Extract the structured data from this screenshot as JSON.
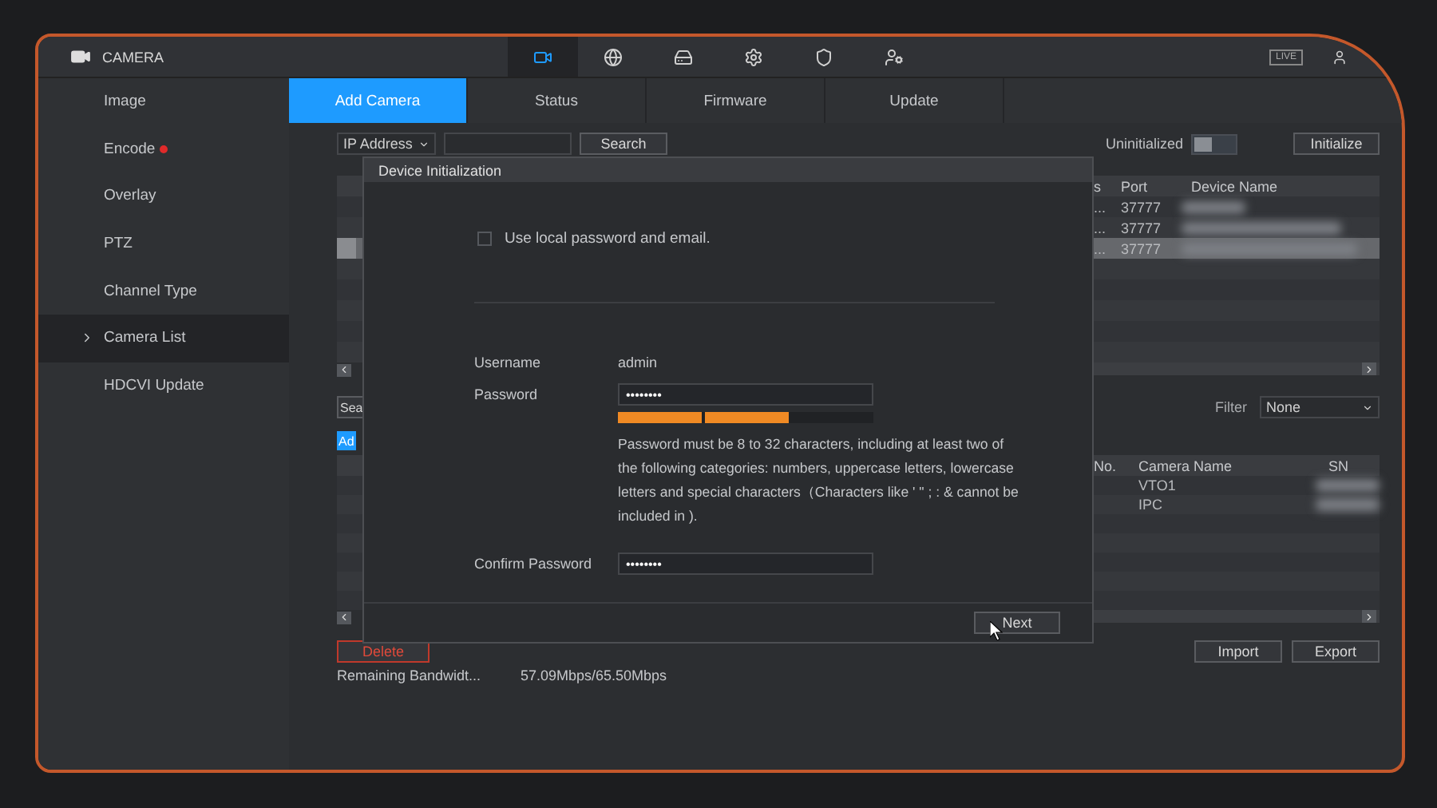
{
  "top_bar": {
    "title": "CAMERA",
    "nav_icons": [
      {
        "kind": "camera",
        "selected": true
      },
      {
        "kind": "network",
        "selected": false
      },
      {
        "kind": "storage",
        "selected": false
      },
      {
        "kind": "system",
        "selected": false
      },
      {
        "kind": "security",
        "selected": false
      },
      {
        "kind": "account",
        "selected": false
      }
    ],
    "live_badge": "LIVE"
  },
  "sidebar": {
    "items": [
      {
        "label": "Image",
        "selected": false,
        "alert": false
      },
      {
        "label": "Encode",
        "selected": false,
        "alert": true
      },
      {
        "label": "Overlay",
        "selected": false,
        "alert": false
      },
      {
        "label": "PTZ",
        "selected": false,
        "alert": false
      },
      {
        "label": "Channel Type",
        "selected": false,
        "alert": false
      },
      {
        "label": "Camera List",
        "selected": true,
        "alert": false
      },
      {
        "label": "HDCVI Update",
        "selected": false,
        "alert": false
      }
    ]
  },
  "tabs": [
    {
      "label": "Add Camera",
      "selected": true
    },
    {
      "label": "Status",
      "selected": false
    },
    {
      "label": "Firmware",
      "selected": false
    },
    {
      "label": "Update",
      "selected": false
    }
  ],
  "search_bar": {
    "search_type": "IP Address",
    "search_button": "Search",
    "uninitialized_label": "Uninitialized",
    "uninitialized_on": false,
    "initialize_button": "Initialize"
  },
  "device_table": {
    "columns": [
      "s",
      "Port",
      "Device Name"
    ],
    "rows": [
      {
        "cells": [
          "...",
          "37777"
        ],
        "selected": false
      },
      {
        "cells": [
          "...",
          "37777"
        ],
        "selected": false
      },
      {
        "cells": [
          "...",
          "37777"
        ],
        "selected": true
      }
    ]
  },
  "search_devices_button": "Sea",
  "filter": {
    "label": "Filter",
    "value": "None"
  },
  "add_button": "Ad",
  "camera_table": {
    "columns": [
      "No.",
      "Camera Name",
      "SN"
    ],
    "rows": [
      {
        "camera_name": "VTO1"
      },
      {
        "camera_name": "IPC"
      }
    ]
  },
  "delete_button": "Delete",
  "bandwidth": {
    "label": "Remaining Bandwidt...",
    "value": "57.09Mbps/65.50Mbps"
  },
  "import_button": "Import",
  "export_button": "Export",
  "dialog": {
    "title": "Device Initialization",
    "use_local": {
      "label": "Use local password and email.",
      "checked": false
    },
    "username_label": "Username",
    "username": "admin",
    "password_label": "Password",
    "password": "••••••••",
    "strength": {
      "level": 0.67
    },
    "hint": "Password must be 8 to 32 characters, including at least two of the following categories: numbers, uppercase letters, lowercase letters and special characters（Characters like ' \" ; : & cannot be included in ).",
    "confirm_label": "Confirm Password",
    "confirm_password": "••••••••",
    "next_button": "Next"
  }
}
